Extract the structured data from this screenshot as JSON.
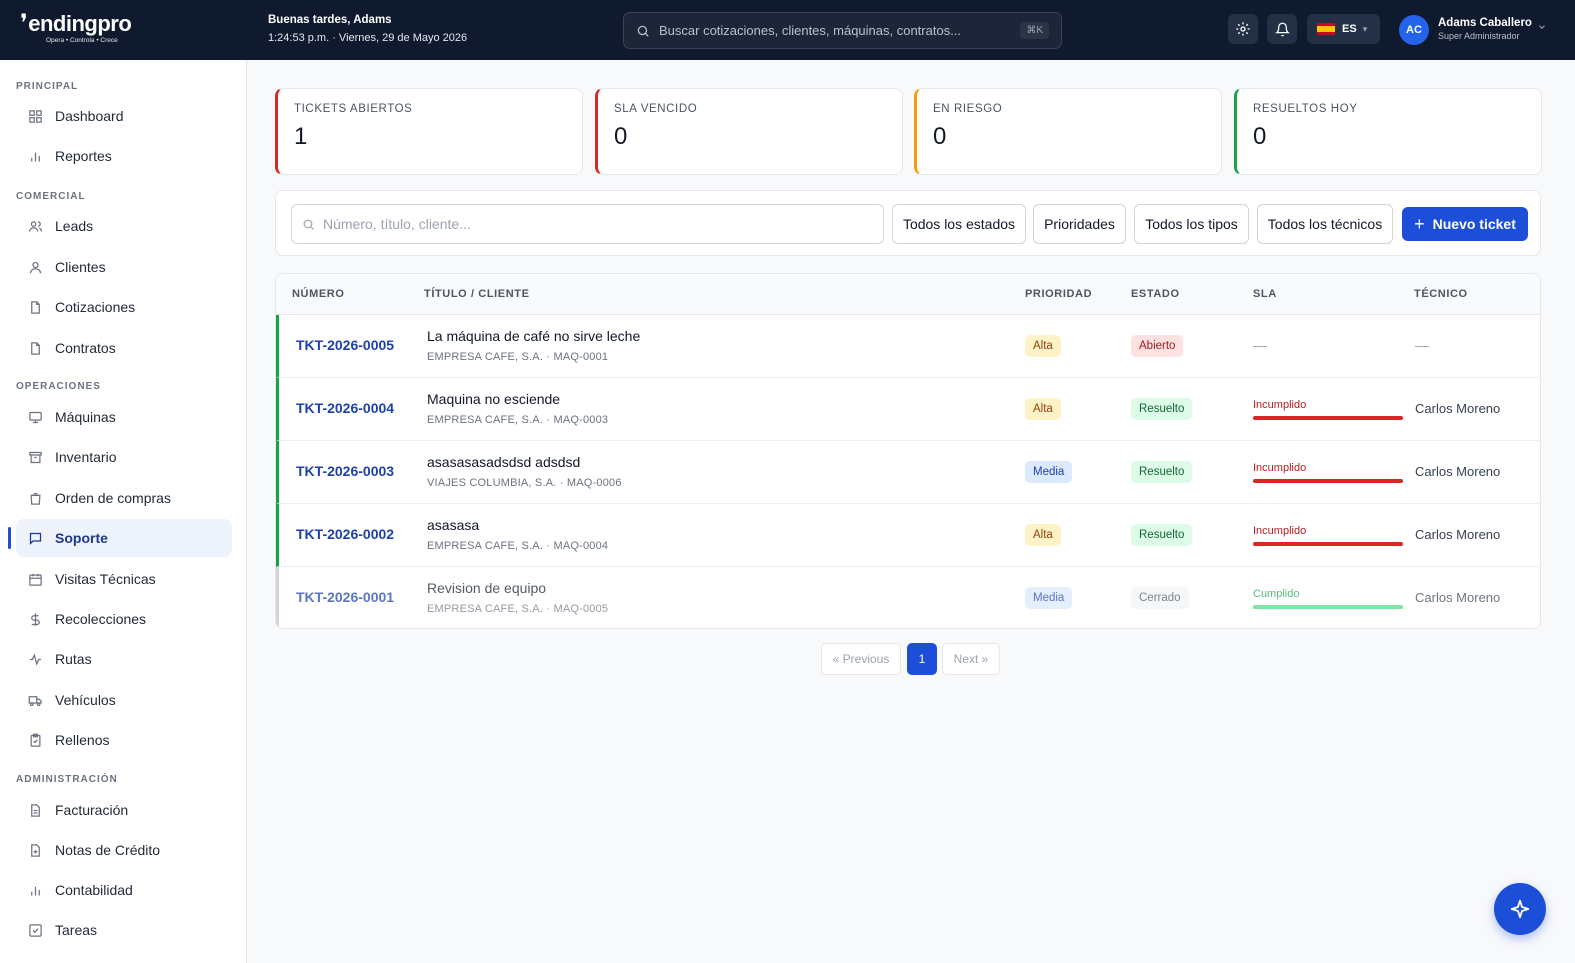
{
  "brand": {
    "name": "endingpro",
    "tagline": "Opera • Controla • Crece"
  },
  "header": {
    "greeting": "Buenas tardes, Adams",
    "datetime": "1:24:53 p.m. · Viernes, 29 de Mayo 2026",
    "search_placeholder": "Buscar cotizaciones, clientes, máquinas, contratos...",
    "search_shortcut": "⌘K",
    "language": "ES",
    "user": {
      "initials": "AC",
      "name": "Adams Caballero",
      "role": "Super Administrador"
    }
  },
  "sidebar": {
    "sections": {
      "principal": "PRINCIPAL",
      "comercial": "COMERCIAL",
      "operaciones": "OPERACIONES",
      "administracion": "ADMINISTRACIÓN"
    },
    "items": {
      "dashboard": "Dashboard",
      "reportes": "Reportes",
      "leads": "Leads",
      "clientes": "Clientes",
      "cotizaciones": "Cotizaciones",
      "contratos": "Contratos",
      "maquinas": "Máquinas",
      "inventario": "Inventario",
      "orden_compras": "Orden de compras",
      "soporte": "Soporte",
      "visitas": "Visitas Técnicas",
      "recolecciones": "Recolecciones",
      "rutas": "Rutas",
      "vehiculos": "Vehículos",
      "rellenos": "Rellenos",
      "facturacion": "Facturación",
      "notas_credito": "Notas de Crédito",
      "contabilidad": "Contabilidad",
      "tareas": "Tareas"
    },
    "active": "Soporte"
  },
  "stats": [
    {
      "label": "TICKETS ABIERTOS",
      "value": "1",
      "accent": "#dc2626"
    },
    {
      "label": "SLA VENCIDO",
      "value": "0",
      "accent": "#dc2626"
    },
    {
      "label": "EN RIESGO",
      "value": "0",
      "accent": "#f59e0b"
    },
    {
      "label": "RESUELTOS HOY",
      "value": "0",
      "accent": "#16a34a"
    }
  ],
  "filters": {
    "search_placeholder": "Número, título, cliente...",
    "estados": "Todos los estados",
    "prioridades": "Prioridades",
    "tipos": "Todos los tipos",
    "tecnicos": "Todos los técnicos",
    "new_ticket": "Nuevo ticket"
  },
  "table": {
    "headers": {
      "numero": "NÚMERO",
      "titulo": "TÍTULO / CLIENTE",
      "prioridad": "PRIORIDAD",
      "estado": "ESTADO",
      "sla": "SLA",
      "tecnico": "TÉCNICO"
    },
    "rows": [
      {
        "numero": "TKT-2026-0005",
        "titulo": "La máquina de café no sirve leche",
        "cliente": "EMPRESA CAFE, S.A. · MAQ-0001",
        "prioridad": "Alta",
        "estado": "Abierto",
        "sla": "—",
        "tecnico": "—"
      },
      {
        "numero": "TKT-2026-0004",
        "titulo": "Maquina no esciende",
        "cliente": "EMPRESA CAFE, S.A. · MAQ-0003",
        "prioridad": "Alta",
        "estado": "Resuelto",
        "sla": "Incumplido",
        "tecnico": "Carlos Moreno"
      },
      {
        "numero": "TKT-2026-0003",
        "titulo": "asasasasadsdsd adsdsd",
        "cliente": "VIAJES COLUMBIA, S.A. · MAQ-0006",
        "prioridad": "Media",
        "estado": "Resuelto",
        "sla": "Incumplido",
        "tecnico": "Carlos Moreno"
      },
      {
        "numero": "TKT-2026-0002",
        "titulo": "asasasa",
        "cliente": "EMPRESA CAFE, S.A. · MAQ-0004",
        "prioridad": "Alta",
        "estado": "Resuelto",
        "sla": "Incumplido",
        "tecnico": "Carlos Moreno"
      },
      {
        "numero": "TKT-2026-0001",
        "titulo": "Revision de equipo",
        "cliente": "EMPRESA CAFE, S.A. · MAQ-0005",
        "prioridad": "Media",
        "estado": "Cerrado",
        "sla": "Cumplido",
        "tecnico": "Carlos Moreno"
      }
    ]
  },
  "pagination": {
    "previous": "« Previous",
    "current": "1",
    "next": "Next »"
  },
  "colors": {
    "brand_blue": "#1d4ed8",
    "topbar": "#0f1a2e",
    "sla_breached": "#dc2626",
    "sla_met": "#4ade80"
  }
}
